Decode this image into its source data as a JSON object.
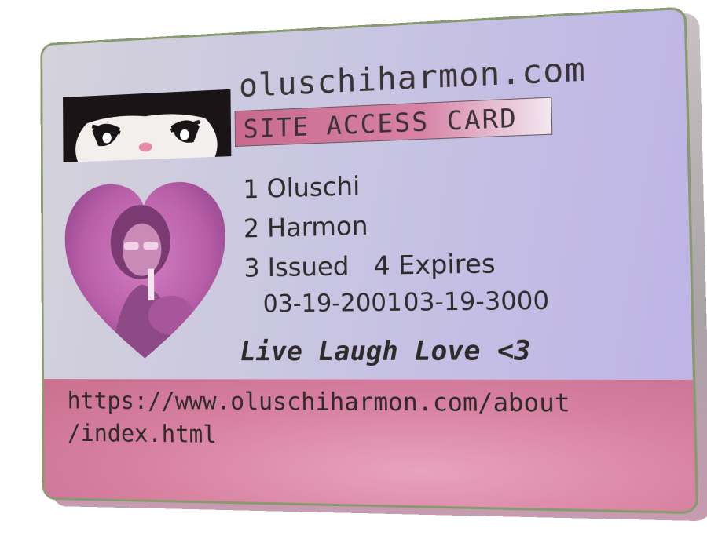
{
  "card": {
    "site_title": "oluschiharmon.com",
    "access_label": "SITE ACCESS CARD",
    "fields": {
      "first_name": "1 Oluschi",
      "last_name": "2 Harmon",
      "issued_label": "3 Issued",
      "expires_label": "4 Expires",
      "issued_date": "03-19-2001",
      "expires_date": "03-19-3000"
    },
    "motto": "Live Laugh Love <3",
    "url_line1": "https://www.oluschiharmon.com/about",
    "url_line2": "/index.html"
  },
  "colors": {
    "card_face": "#c9c6e2",
    "access_band": "#d782a6",
    "url_band": "#d77f9f",
    "border": "#8a9a70"
  },
  "icons": {
    "logo": "kuromi-face-icon",
    "photo": "heart-photo"
  }
}
